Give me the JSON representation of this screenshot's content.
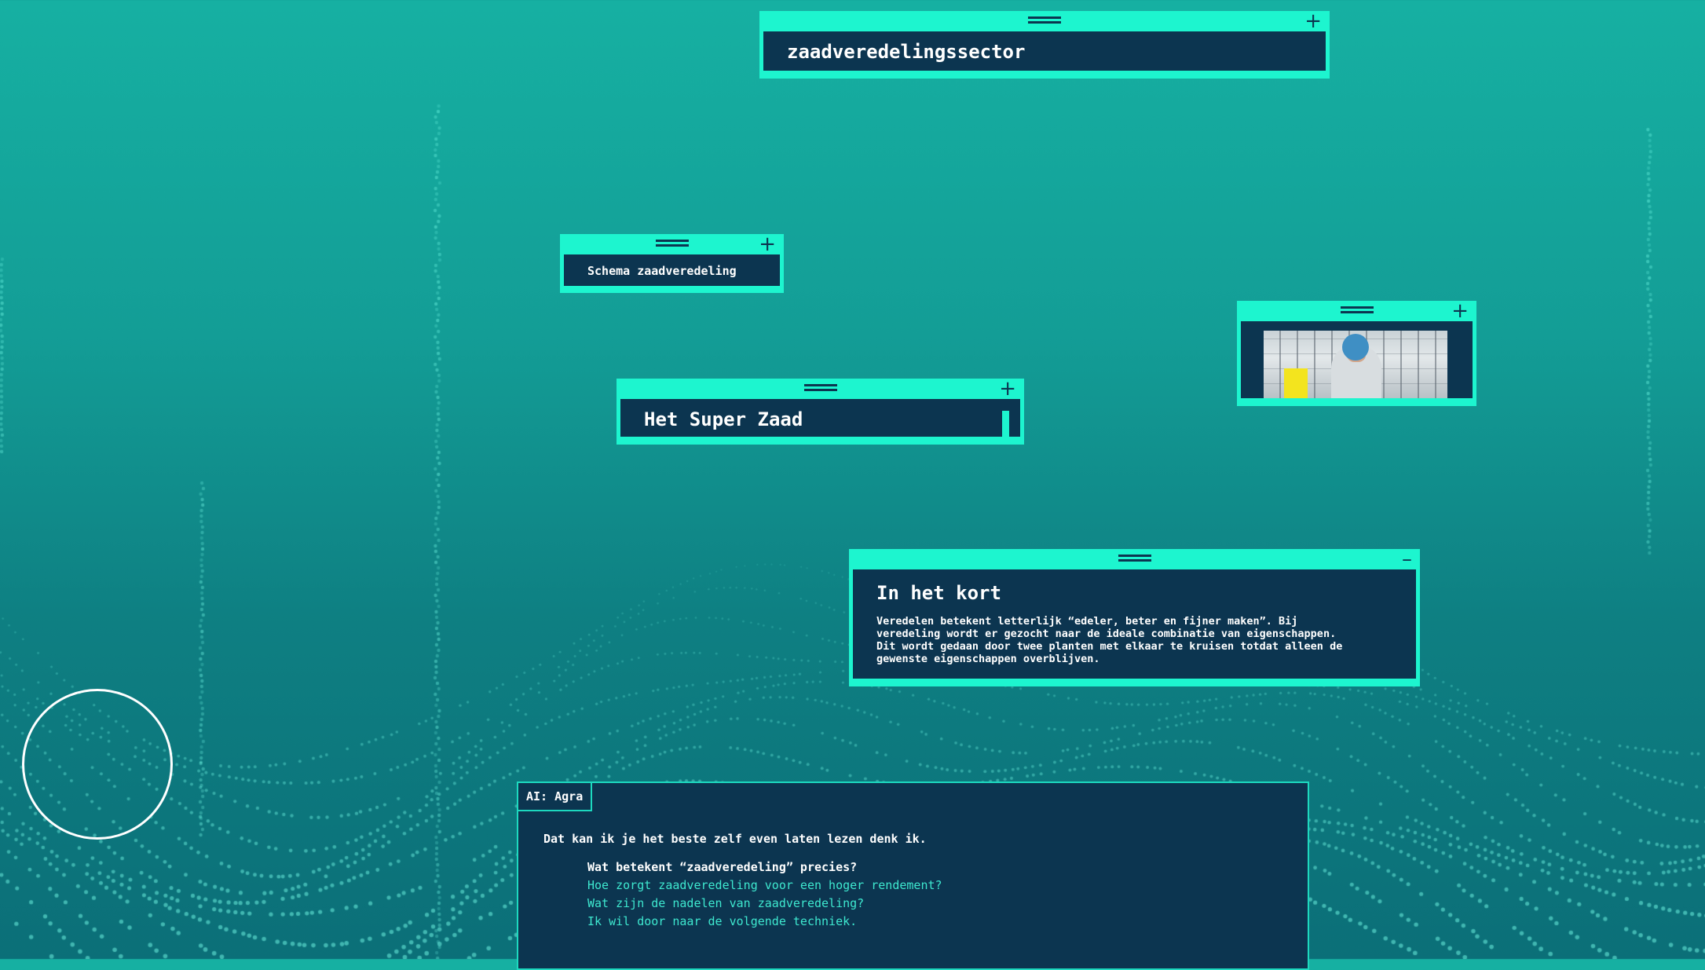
{
  "colors": {
    "accent": "#1df5cf",
    "panel_body": "#0c3550",
    "option_text": "#3ee8cf"
  },
  "panels": {
    "title": {
      "text": "zaadveredelingssector",
      "control_icon": "plus-icon",
      "control_glyph": "+"
    },
    "schema": {
      "text": "Schema zaadveredeling",
      "control_icon": "plus-icon",
      "control_glyph": "+"
    },
    "super_zaad": {
      "text": "Het Super Zaad",
      "control_icon": "plus-icon",
      "control_glyph": "+"
    },
    "photo": {
      "control_icon": "plus-icon",
      "control_glyph": "+"
    },
    "kort": {
      "heading": "In het kort",
      "body": "Veredelen betekent letterlijk “edeler, beter en fijner maken”. Bij\nveredeling wordt er gezocht naar de ideale combinatie van eigenschappen.\nDit wordt gedaan door twee planten met elkaar te kruisen totdat alleen de\ngewenste eigenschappen overblijven.",
      "control_icon": "minus-icon",
      "control_glyph": "–"
    }
  },
  "chat": {
    "tag": "AI: Agra",
    "message": "Dat kan ik je het beste zelf even laten lezen denk ik.",
    "options": [
      "Wat betekent “zaadveredeling” precies?",
      "Hoe zorgt zaadveredeling voor een hoger rendement?",
      "Wat zijn de nadelen van zaadveredeling?",
      "Ik wil door naar de volgende techniek."
    ],
    "selected_option": 0
  }
}
